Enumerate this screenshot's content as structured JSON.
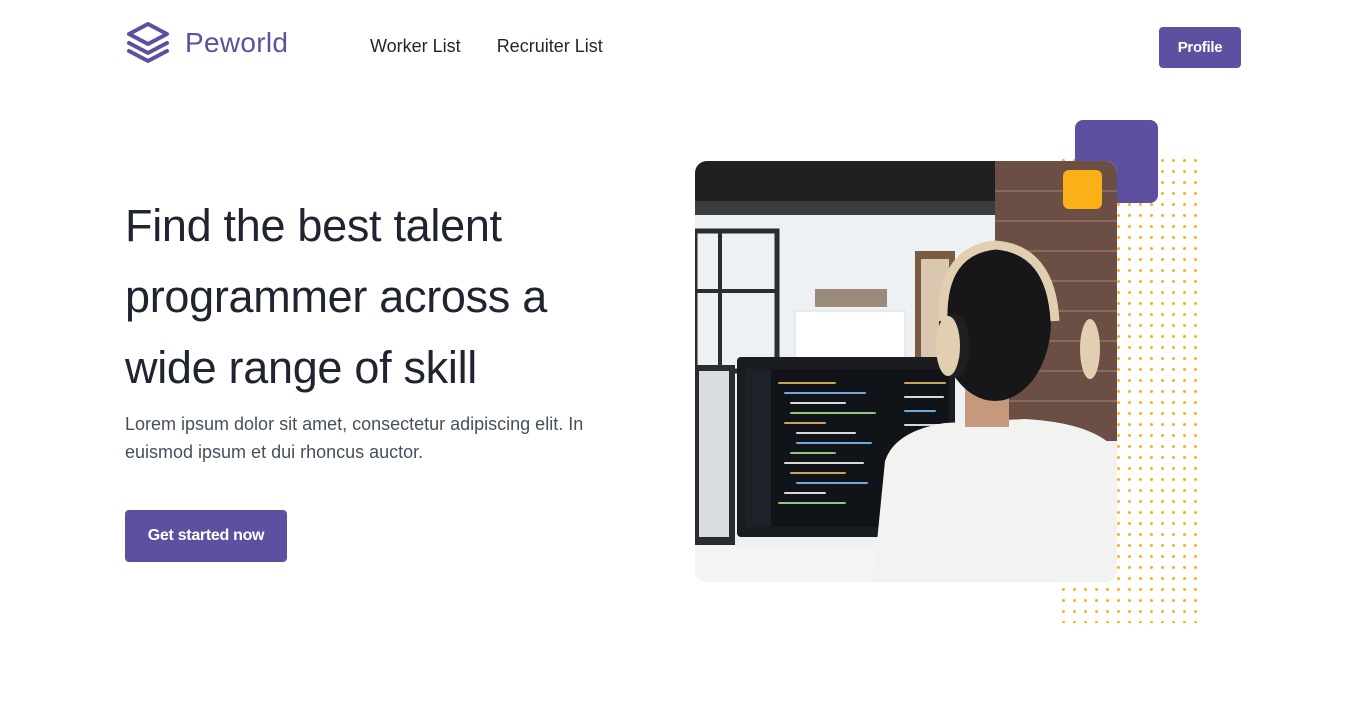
{
  "brand": {
    "name": "Peworld",
    "icon": "stacked-layers-icon"
  },
  "nav": {
    "links": [
      {
        "label": "Worker List"
      },
      {
        "label": "Recruiter List"
      }
    ],
    "profile_label": "Profile"
  },
  "hero": {
    "title": "Find the best talent programmer across a wide range of skill",
    "description": "Lorem ipsum dolor sit amet, consectetur adipiscing elit. In euismod ipsum et dui rhoncus auctor.",
    "cta_label": "Get started now",
    "image": "programmer-at-computer-photo"
  },
  "colors": {
    "primary": "#5e50a1",
    "accent": "#fbb017",
    "text": "#1f2430",
    "muted_text": "#46505c"
  }
}
